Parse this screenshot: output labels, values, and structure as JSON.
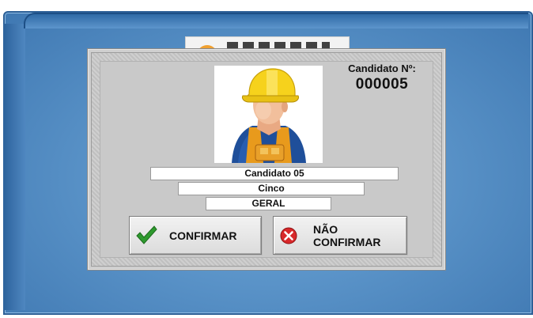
{
  "candidate": {
    "number_label": "Candidato Nº:",
    "number": "000005",
    "name": "Candidato 05",
    "nickname": "Cinco",
    "category": "GERAL",
    "photo_icon": "construction-worker-avatar-icon"
  },
  "actions": {
    "confirm_label": "CONFIRMAR",
    "confirm_icon": "checkmark-icon",
    "deny_label": "NÃO CONFIRMAR",
    "deny_icon": "error-x-icon"
  },
  "colors": {
    "backdrop": "#5a93c8",
    "dialog": "#cfcfcf",
    "confirm_check": "#2e9a2e",
    "deny_circle": "#d8282a"
  }
}
